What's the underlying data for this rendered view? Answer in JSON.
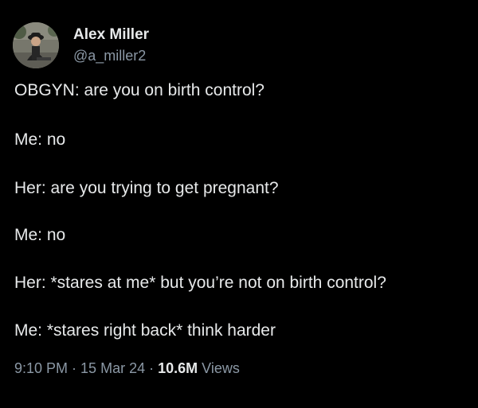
{
  "author": {
    "display_name": "Alex Miller",
    "handle": "@a_miller2",
    "avatar": "avatar-photo"
  },
  "tweet": {
    "lines": [
      "OBGYN: are you on birth control?",
      "Me: no",
      "Her: are you trying to get pregnant?",
      "Me: no",
      "Her: *stares at me* but you’re not on birth control?",
      "Me: *stares right back* think harder"
    ]
  },
  "meta": {
    "time": "9:10 PM",
    "date": "15 Mar 24",
    "views_count": "10.6M",
    "views_label": "Views",
    "separator": "·"
  },
  "colors": {
    "background": "#000000",
    "text_primary": "#e7e9ea",
    "text_secondary": "#8b98a5"
  }
}
